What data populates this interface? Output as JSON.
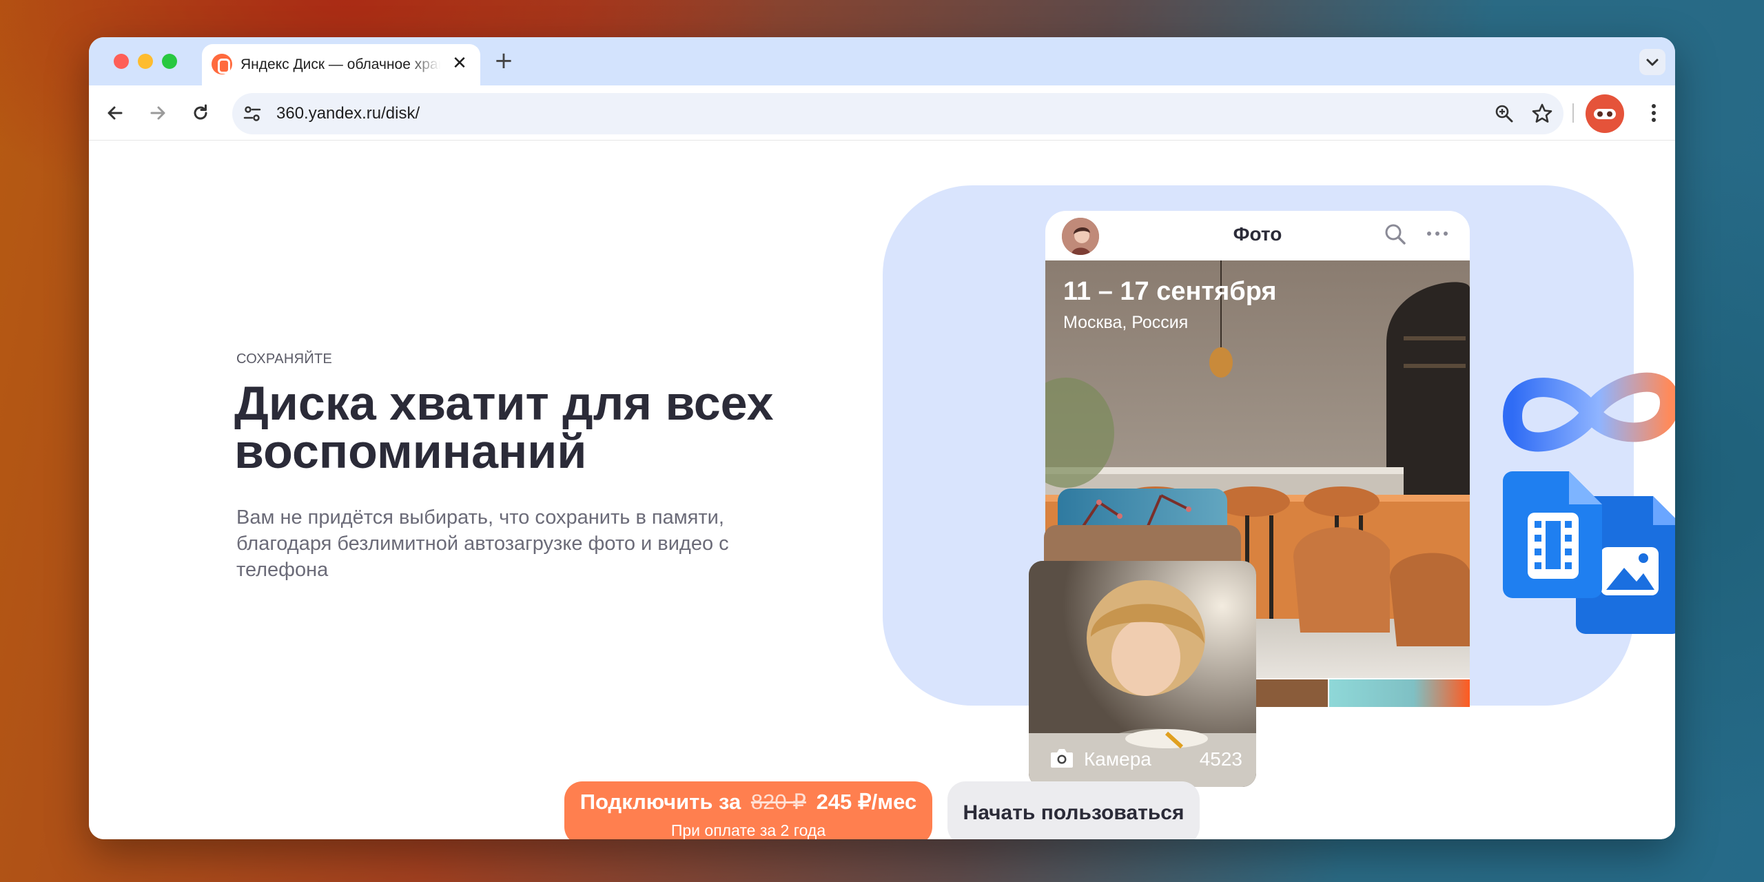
{
  "browser": {
    "tab_title": "Яндекс Диск — облачное хранилище",
    "tab_close": "✕",
    "new_tab": "+",
    "url": "360.yandex.ru/disk/",
    "icons": [
      "back-arrow-icon",
      "forward-arrow-icon",
      "reload-icon",
      "tune-icon",
      "zoom-icon",
      "star-icon",
      "profile-avatar",
      "kebab-menu-icon",
      "tab-menu-chevron-icon"
    ]
  },
  "hero": {
    "eyebrow": "СОХРАНЯЙТЕ",
    "headline": "Диска хватит для всех воспоминаний",
    "subtext": "Вам не придётся выбирать, что сохранить в памяти, благодаря безлимитной автозагрузке фото и видео с телефона"
  },
  "phone": {
    "title": "Фото",
    "date_range": "11 – 17 сентября",
    "location": "Москва, Россия",
    "album_name": "Камера",
    "album_count": "4523"
  },
  "cta": {
    "primary_prefix": "Подключить за",
    "primary_old_price": "820 ₽",
    "primary_new_price": "245 ₽/мес",
    "primary_note": "При оплате за 2 года",
    "secondary_label": "Начать пользоваться"
  },
  "colors": {
    "accent_orange": "#ff7f4f",
    "hero_bg": "#d9e4fd",
    "file_blue": "#1f7ff0"
  }
}
